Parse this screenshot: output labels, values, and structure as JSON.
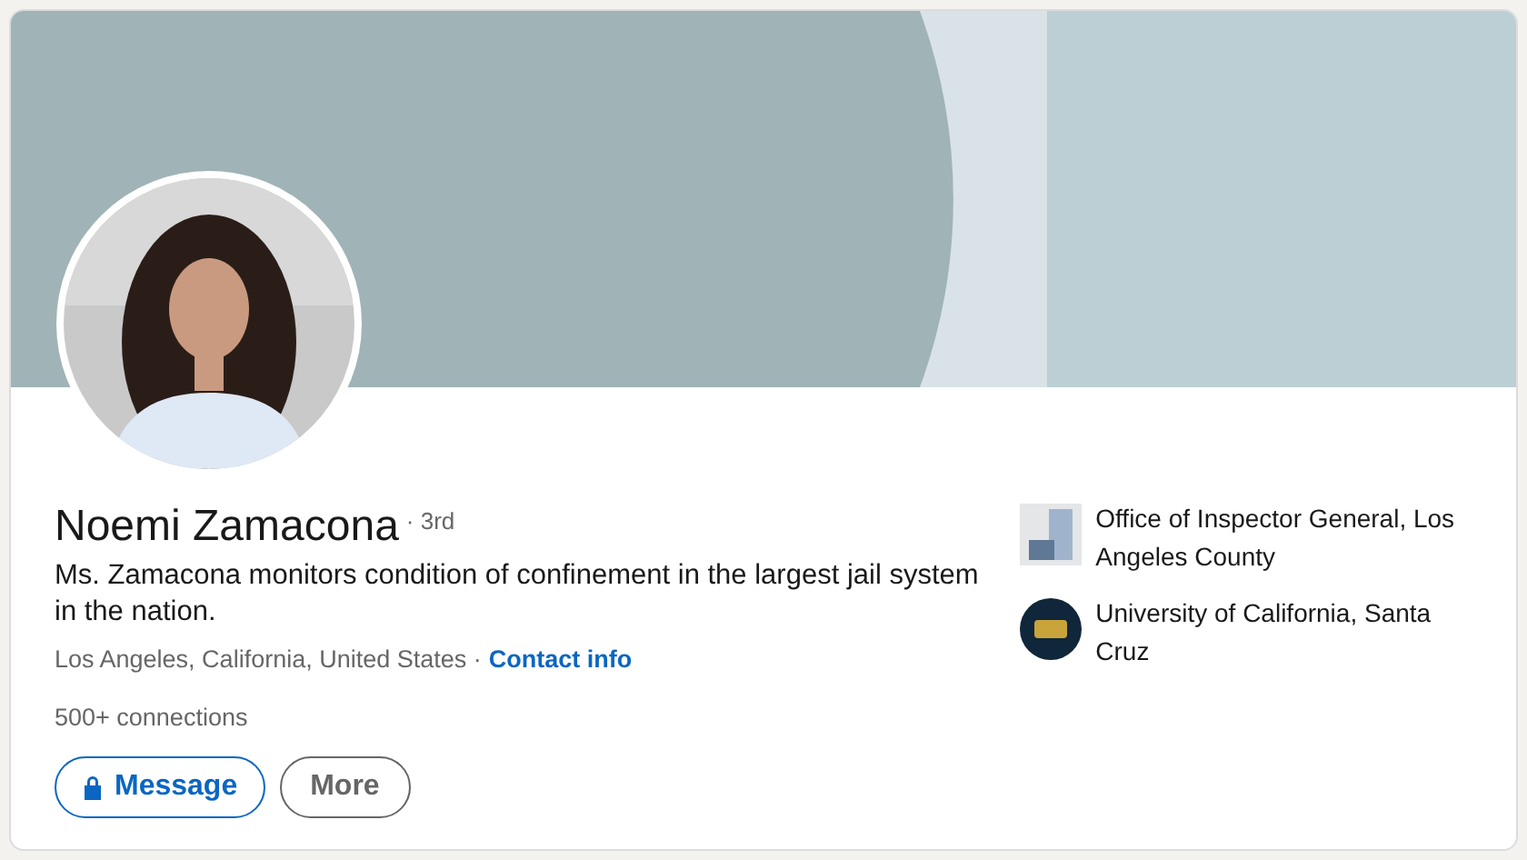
{
  "profile": {
    "name": "Noemi Zamacona",
    "degree": "· 3rd",
    "headline": "Ms. Zamacona monitors condition of confinement in the largest jail system in the nation.",
    "location": "Los Angeles, California, United States ·",
    "contact_link": "Contact info",
    "connections": "500+ connections"
  },
  "actions": [
    {
      "label": "Message",
      "kind": "primary"
    },
    {
      "label": "More",
      "kind": "secondary"
    }
  ],
  "affiliations": [
    {
      "name": "Office of Inspector General, Los Angeles County",
      "kind": "org"
    },
    {
      "name": "University of California, Santa Cruz",
      "kind": "school"
    }
  ]
}
